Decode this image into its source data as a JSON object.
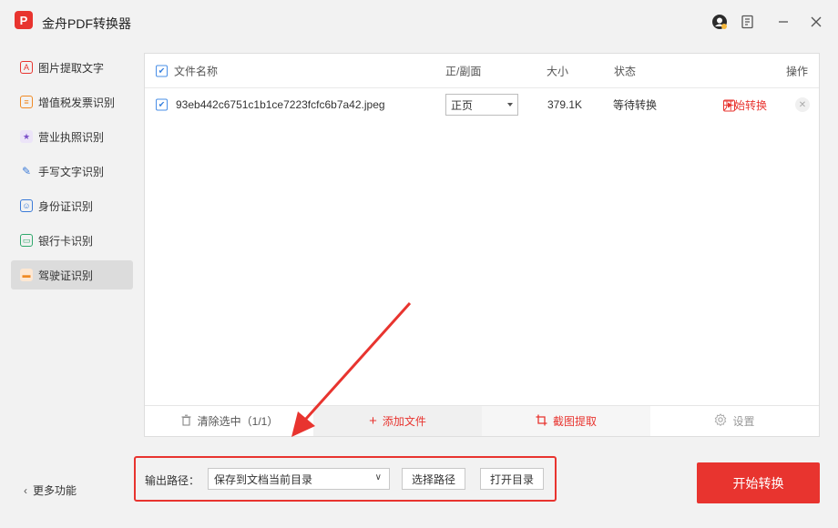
{
  "app": {
    "title": "金舟PDF转换器",
    "logo_text": "P",
    "brand_color": "#e8342f"
  },
  "window_controls": [
    {
      "name": "account-icon",
      "symbol": "◕"
    },
    {
      "name": "feedback-icon",
      "symbol": "▤"
    },
    {
      "name": "minimize-icon",
      "symbol": "—"
    },
    {
      "name": "close-icon",
      "symbol": "✕"
    }
  ],
  "sidebar": {
    "items": [
      {
        "label": "图片提取文字",
        "icon": "image-text-icon",
        "icon_color": "#e8342f",
        "active": false
      },
      {
        "label": "增值税发票识别",
        "icon": "invoice-icon",
        "icon_color": "#f08a24",
        "active": false
      },
      {
        "label": "营业执照识别",
        "icon": "license-icon",
        "icon_color": "#7b4fc9",
        "active": false
      },
      {
        "label": "手写文字识别",
        "icon": "handwriting-icon",
        "icon_color": "#3b7bd8",
        "active": false
      },
      {
        "label": "身份证识别",
        "icon": "id-card-icon",
        "icon_color": "#3b7bd8",
        "active": false
      },
      {
        "label": "银行卡识别",
        "icon": "bank-card-icon",
        "icon_color": "#2fa86b",
        "active": false
      },
      {
        "label": "驾驶证识别",
        "icon": "driver-license-icon",
        "icon_color": "#f08a24",
        "active": true
      }
    ],
    "more_label": "更多功能"
  },
  "table": {
    "headers": {
      "name": "文件名称",
      "side": "正/副面",
      "size": "大小",
      "status": "状态",
      "action": "操作"
    },
    "rows": [
      {
        "checked": true,
        "name": "93eb442c6751c1b1ce7223fcfc6b7a42.jpeg",
        "side": "正页",
        "size": "379.1K",
        "status": "等待转换",
        "action": "开始转换"
      }
    ]
  },
  "toolbar": {
    "clear_label": "清除选中（1/1）",
    "add_label": "添加文件",
    "crop_label": "截图提取",
    "settings_label": "设置"
  },
  "output": {
    "label": "输出路径：",
    "selected": "保存到文档当前目录",
    "choose_label": "选择路径",
    "open_label": "打开目录"
  },
  "convert_label": "开始转换"
}
